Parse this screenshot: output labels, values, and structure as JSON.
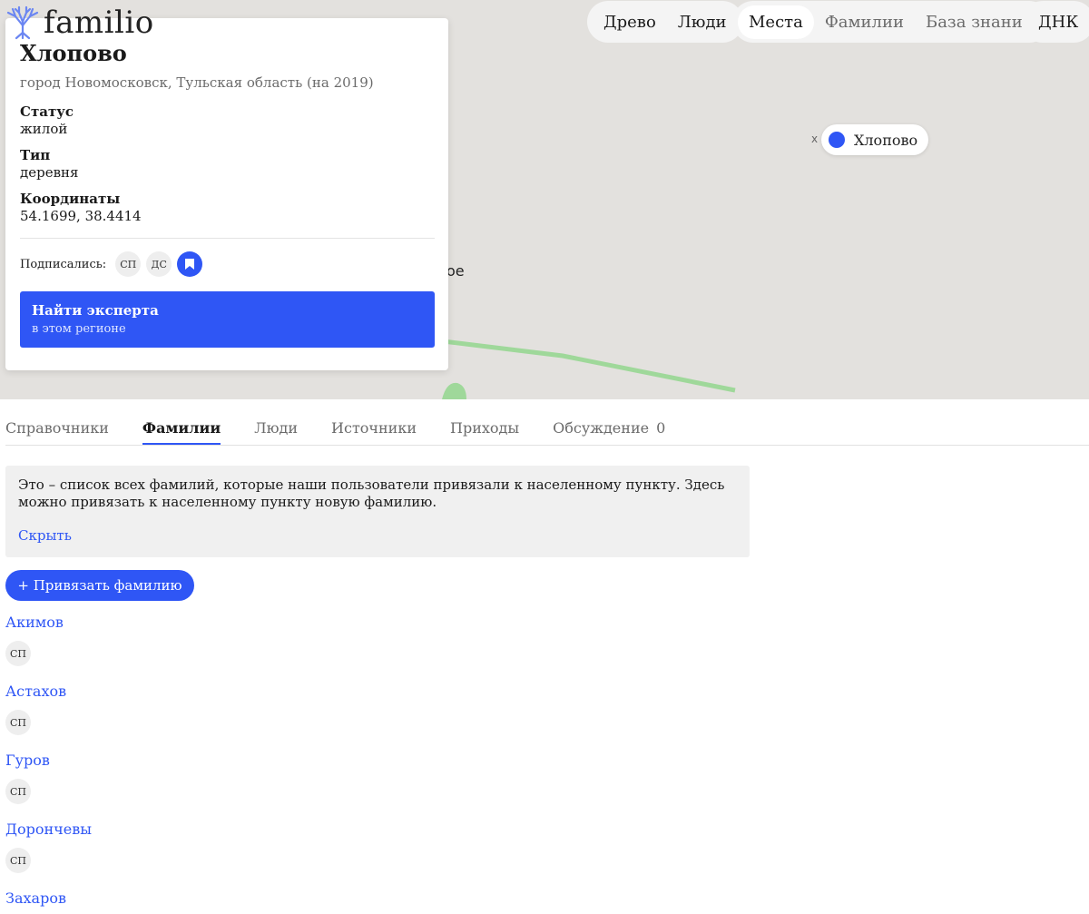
{
  "logo": {
    "text": "familio"
  },
  "nav": {
    "group1": [
      "Древо",
      "Люди"
    ],
    "group2": [
      "Места",
      "Фамилии",
      "База знаний"
    ],
    "group3": [
      "ДНК"
    ]
  },
  "map": {
    "pin_label": "Хлопово",
    "partial_label": "ое",
    "x_mark": "x"
  },
  "place": {
    "title": "Хлопово",
    "subtitle": "город Новомосковск, Тульская область (на 2019)",
    "status_label": "Статус",
    "status_value": "жилой",
    "type_label": "Тип",
    "type_value": "деревня",
    "coords_label": "Координаты",
    "coords_value": "54.1699, 38.4414",
    "subscribed_label": "Подписались:",
    "subscribers": [
      "СП",
      "ДС"
    ],
    "expert_title": "Найти эксперта",
    "expert_sub": "в этом регионе"
  },
  "tabs": {
    "items": [
      "Справочники",
      "Фамилии",
      "Люди",
      "Источники",
      "Приходы",
      "Обсуждение"
    ],
    "discussion_count": "0"
  },
  "notice": {
    "text": "Это – список всех фамилий, которые наши пользователи привязали к населенному пункту. Здесь можно привязать к населенному пункту новую фамилию.",
    "hide": "Скрыть"
  },
  "add_surname_button": "+ Привязать фамилию",
  "surnames": [
    {
      "name": "Акимов",
      "user": "СП"
    },
    {
      "name": "Астахов",
      "user": "СП"
    },
    {
      "name": "Гуров",
      "user": "СП"
    },
    {
      "name": "Дорончевы",
      "user": "СП"
    },
    {
      "name": "Захаров",
      "user": ""
    }
  ],
  "colors": {
    "accent": "#2f56f5",
    "map_bg": "#e3e1de",
    "road_green": "#9fd89a"
  }
}
